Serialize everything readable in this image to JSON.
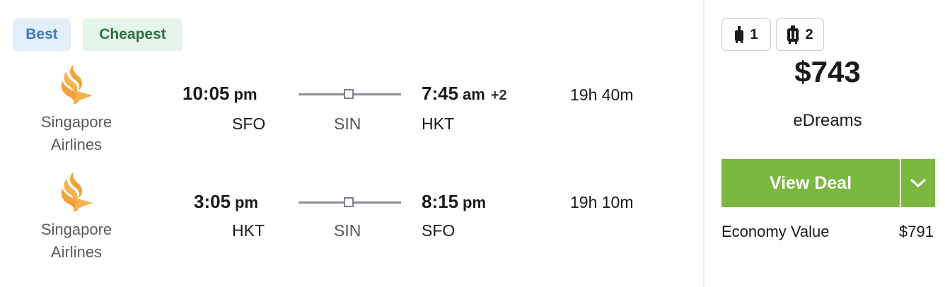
{
  "badges": {
    "best": "Best",
    "cheapest": "Cheapest"
  },
  "legs": [
    {
      "airline": "Singapore Airlines",
      "depart_time": "10:05",
      "depart_ampm": "pm",
      "arrive_time": "7:45",
      "arrive_ampm": "am",
      "day_offset": "+2",
      "origin": "SFO",
      "stop": "SIN",
      "destination": "HKT",
      "duration": "19h 40m"
    },
    {
      "airline": "Singapore Airlines",
      "depart_time": "3:05",
      "depart_ampm": "pm",
      "arrive_time": "8:15",
      "arrive_ampm": "pm",
      "origin": "HKT",
      "stop": "SIN",
      "destination": "SFO",
      "duration": "19h 10m"
    }
  ],
  "bags": {
    "carry_on_count": "1",
    "checked_count": "2",
    "carry_on_icon": "carry-on-bag-icon",
    "checked_icon": "checked-bag-icon"
  },
  "price": "$743",
  "provider": "eDreams",
  "deal_button": "View Deal",
  "fare": {
    "name": "Economy Value",
    "price": "$791"
  },
  "colors": {
    "deal_green": "#7ab840",
    "best_blue": "#3d7bc2",
    "cheapest_green": "#2e6e3f",
    "logo_orange": "#f2a23a"
  }
}
